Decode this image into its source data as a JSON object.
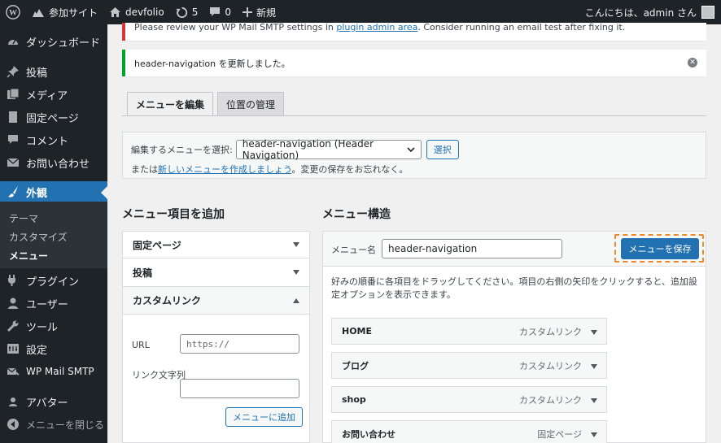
{
  "adminbar": {
    "site_name": "参加サイト",
    "site2_name": "devfolio",
    "updates_count": "5",
    "comments_count": "0",
    "new_label": "新規",
    "greeting": "こんにちは、admin さん"
  },
  "sidebar": {
    "dashboard": "ダッシュボード",
    "posts": "投稿",
    "media": "メディア",
    "pages": "固定ページ",
    "comments": "コメント",
    "contact": "お問い合わせ",
    "appearance": "外観",
    "sub_theme": "テーマ",
    "sub_customize": "カスタマイズ",
    "sub_menus": "メニュー",
    "plugins": "プラグイン",
    "users": "ユーザー",
    "tools": "ツール",
    "settings": "設定",
    "wpmail": "WP Mail SMTP",
    "avatar": "アバター",
    "collapse": "メニューを閉じる"
  },
  "notices": {
    "error_text_before": "Please review your WP Mail SMTP settings in ",
    "error_link": "plugin admin area",
    "error_text_after": ". Consider running an email test after fixing it.",
    "success_text": "header-navigation を更新しました。"
  },
  "tabs": {
    "edit_menus": "メニューを編集",
    "manage_locations": "位置の管理"
  },
  "select_menu": {
    "label": "編集するメニューを選択:",
    "selected": "header-navigation (Header Navigation)",
    "select_button": "選択",
    "note_prefix": "または",
    "create_link": "新しいメニューを作成しましょう",
    "note_suffix": "。変更の保存をお忘れなく。"
  },
  "add_items": {
    "title": "メニュー項目を追加",
    "sections": [
      "固定ページ",
      "投稿",
      "カスタムリンク"
    ],
    "url_label": "URL",
    "url_placeholder": "https://",
    "link_text_label": "リンク文字列",
    "add_button": "メニューに追加"
  },
  "structure": {
    "title": "メニュー構造",
    "menu_name_label": "メニュー名",
    "menu_name_value": "header-navigation",
    "save_button": "メニューを保存",
    "instructions": "好みの順番に各項目をドラッグしてください。項目の右側の矢印をクリックすると、追加設定オプションを表示できます。",
    "items": [
      {
        "label": "HOME",
        "type": "カスタムリンク"
      },
      {
        "label": "ブログ",
        "type": "カスタムリンク"
      },
      {
        "label": "shop",
        "type": "カスタムリンク"
      },
      {
        "label": "お問い合わせ",
        "type": "固定ページ"
      }
    ]
  },
  "colors": {
    "accent": "#2271b1",
    "sidebar_bg": "#1d2327",
    "success": "#00a32a",
    "error": "#d63638",
    "highlight_frame": "#f0892c"
  }
}
